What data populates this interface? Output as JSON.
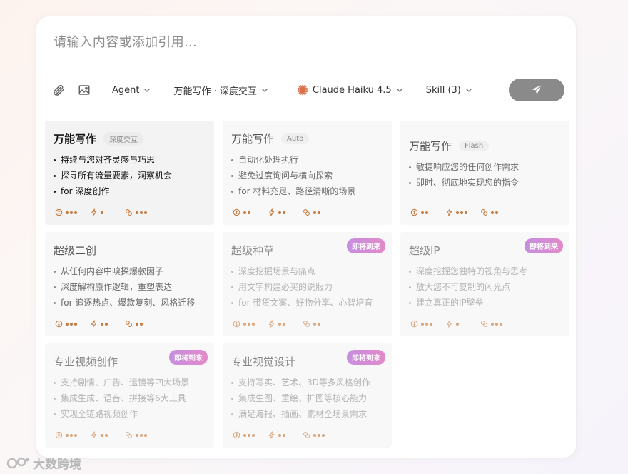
{
  "composer": {
    "placeholder": "请输入内容或添加引用..."
  },
  "toolbar": {
    "agent_label": "Agent",
    "mode_label": "万能写作 · 深度交互",
    "model_label": "Claude Haiku 4.5",
    "skill_label": "Skill (3)"
  },
  "cards": [
    {
      "title": "万能写作",
      "tag": "深度交互",
      "badge": "",
      "state": "active",
      "bullets": [
        "持续与您对齐灵感与巧思",
        "探寻所有流量要素，洞察机会",
        "for 深度创作"
      ],
      "levels": [
        3,
        1,
        3
      ]
    },
    {
      "title": "万能写作",
      "tag": "Auto",
      "badge": "",
      "state": "normal",
      "bullets": [
        "自动化处理执行",
        "避免过度询问与横向探索",
        "for 材料充足、路径清晰的场景"
      ],
      "levels": [
        2,
        2,
        2
      ]
    },
    {
      "title": "万能写作",
      "tag": "Flash",
      "badge": "",
      "state": "normal",
      "bullets": [
        "敏捷响应您的任何创作需求",
        "即时、彻底地实现您的指令"
      ],
      "levels": [
        2,
        3,
        2
      ]
    },
    {
      "title": "超级二创",
      "tag": "",
      "badge": "",
      "state": "normal",
      "bullets": [
        "从任何内容中嗅探爆款因子",
        "深度解构原作逻辑，重塑表达",
        "for 追逐热点、爆款复刻、风格迁移"
      ],
      "levels": [
        3,
        2,
        2
      ]
    },
    {
      "title": "超级种草",
      "tag": "",
      "badge": "即将到来",
      "state": "dim",
      "bullets": [
        "深度挖掘场景与痛点",
        "用文字构建必买的说服力",
        "for 带货文案、好物分享、心智培育"
      ],
      "levels": [
        3,
        2,
        2
      ]
    },
    {
      "title": "超级IP",
      "tag": "",
      "badge": "即将到来",
      "state": "dim",
      "bullets": [
        "深度挖掘您独特的视角与思考",
        "放大您不可复制的闪光点",
        "建立真正的IP壁垒"
      ],
      "levels": [
        3,
        1,
        3
      ]
    },
    {
      "title": "专业视频创作",
      "tag": "",
      "badge": "即将到来",
      "state": "dim",
      "bullets": [
        "支持剧情、广告、运镜等四大场景",
        "集成生成、语音、拼接等6大工具",
        "实现全链路视频创作"
      ],
      "levels": [
        3,
        2,
        3
      ]
    },
    {
      "title": "专业视觉设计",
      "tag": "",
      "badge": "即将到来",
      "state": "dim",
      "bullets": [
        "支持写实、艺术、3D等多风格创作",
        "集成生图、重绘、扩图等核心能力",
        "满足海报、插画、素材全场景需求"
      ],
      "levels": [
        3,
        2,
        3
      ]
    }
  ],
  "watermark": {
    "text": "大数跨境"
  },
  "colors": {
    "accent": "#c47a3f",
    "badge": "#d98bd0",
    "send": "#8a8a8a"
  },
  "icons": [
    "paperclip-icon",
    "image-icon",
    "chevron-down-icon",
    "claude-sunburst-icon",
    "send-icon",
    "depth-icon",
    "speed-icon",
    "link-icon"
  ]
}
